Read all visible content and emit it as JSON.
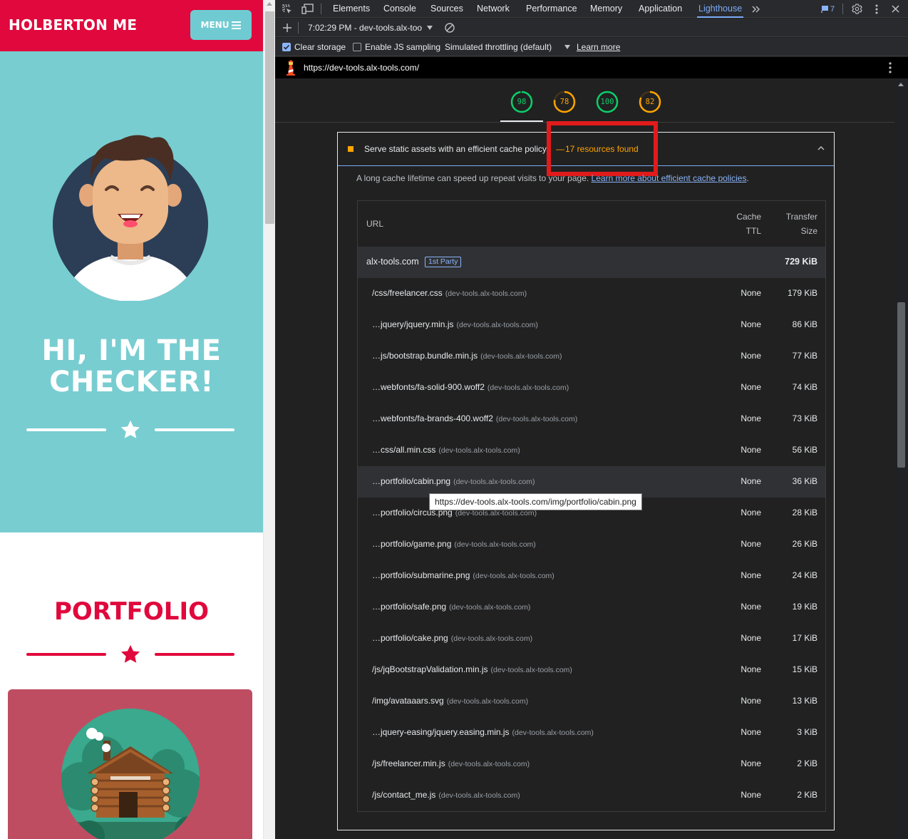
{
  "site": {
    "brand": "HOLBERTON ME",
    "menu_label": "MENU",
    "hero_title_line1": "HI, I'M THE",
    "hero_title_line2": "CHECKER!",
    "portfolio_title": "PORTFOLIO",
    "colors": {
      "nav": "#e0083c",
      "hero": "#78cdd1",
      "card": "#bf4d62",
      "accent": "#e0083c"
    }
  },
  "devtools": {
    "tabs": [
      "Elements",
      "Console",
      "Sources",
      "Network",
      "Performance",
      "Memory",
      "Application",
      "Lighthouse"
    ],
    "active_tab": "Lighthouse",
    "issues_count": "7",
    "toolbar": {
      "report_label": "7:02:29 PM - dev-tools.alx-too",
      "clear_storage": "Clear storage",
      "js_sampling": "Enable JS sampling",
      "throttling": "Simulated throttling (default)",
      "learn_more": "Learn more"
    },
    "report_url": "https://dev-tools.alx-tools.com/"
  },
  "lighthouse": {
    "gauges": [
      {
        "value": "98",
        "color": "#0cce6b",
        "fraction": 0.98
      },
      {
        "value": "78",
        "color": "#ffa400",
        "fraction": 0.78
      },
      {
        "value": "100",
        "color": "#0cce6b",
        "fraction": 1.0
      },
      {
        "value": "82",
        "color": "#ffa400",
        "fraction": 0.82
      }
    ],
    "audit": {
      "title": "Serve static assets with an efficient cache policy",
      "separator": "—",
      "display_value": "17 resources found",
      "description_text": "A long cache lifetime can speed up repeat visits to your page.",
      "description_link": "Learn more about efficient cache policies",
      "description_end": "."
    },
    "table": {
      "col_url": "URL",
      "col_ttl_1": "Cache",
      "col_ttl_2": "TTL",
      "col_size_1": "Transfer",
      "col_size_2": "Size",
      "group_name": "alx-tools.com",
      "group_badge": "1st Party",
      "group_size": "729 KiB",
      "rows": [
        {
          "url": "/css/freelancer.css",
          "host": "(dev-tools.alx-tools.com)",
          "ttl": "None",
          "size": "179 KiB"
        },
        {
          "url": "…jquery/jquery.min.js",
          "host": "(dev-tools.alx-tools.com)",
          "ttl": "None",
          "size": "86 KiB"
        },
        {
          "url": "…js/bootstrap.bundle.min.js",
          "host": "(dev-tools.alx-tools.com)",
          "ttl": "None",
          "size": "77 KiB"
        },
        {
          "url": "…webfonts/fa-solid-900.woff2",
          "host": "(dev-tools.alx-tools.com)",
          "ttl": "None",
          "size": "74 KiB"
        },
        {
          "url": "…webfonts/fa-brands-400.woff2",
          "host": "(dev-tools.alx-tools.com)",
          "ttl": "None",
          "size": "73 KiB"
        },
        {
          "url": "…css/all.min.css",
          "host": "(dev-tools.alx-tools.com)",
          "ttl": "None",
          "size": "56 KiB"
        },
        {
          "url": "…portfolio/cabin.png",
          "host": "(dev-tools.alx-tools.com)",
          "ttl": "None",
          "size": "36 KiB"
        },
        {
          "url": "…portfolio/circus.png",
          "host": "(dev-tools.alx-tools.com)",
          "ttl": "None",
          "size": "28 KiB"
        },
        {
          "url": "…portfolio/game.png",
          "host": "(dev-tools.alx-tools.com)",
          "ttl": "None",
          "size": "26 KiB"
        },
        {
          "url": "…portfolio/submarine.png",
          "host": "(dev-tools.alx-tools.com)",
          "ttl": "None",
          "size": "24 KiB"
        },
        {
          "url": "…portfolio/safe.png",
          "host": "(dev-tools.alx-tools.com)",
          "ttl": "None",
          "size": "19 KiB"
        },
        {
          "url": "…portfolio/cake.png",
          "host": "(dev-tools.alx-tools.com)",
          "ttl": "None",
          "size": "17 KiB"
        },
        {
          "url": "/js/jqBootstrapValidation.min.js",
          "host": "(dev-tools.alx-tools.com)",
          "ttl": "None",
          "size": "15 KiB"
        },
        {
          "url": "/img/avataaars.svg",
          "host": "(dev-tools.alx-tools.com)",
          "ttl": "None",
          "size": "13 KiB"
        },
        {
          "url": "…jquery-easing/jquery.easing.min.js",
          "host": "(dev-tools.alx-tools.com)",
          "ttl": "None",
          "size": "3 KiB"
        },
        {
          "url": "/js/freelancer.min.js",
          "host": "(dev-tools.alx-tools.com)",
          "ttl": "None",
          "size": "2 KiB"
        },
        {
          "url": "/js/contact_me.js",
          "host": "(dev-tools.alx-tools.com)",
          "ttl": "None",
          "size": "2 KiB"
        }
      ],
      "hovered_row_index": 6
    },
    "tooltip": "https://dev-tools.alx-tools.com/img/portfolio/cabin.png"
  }
}
